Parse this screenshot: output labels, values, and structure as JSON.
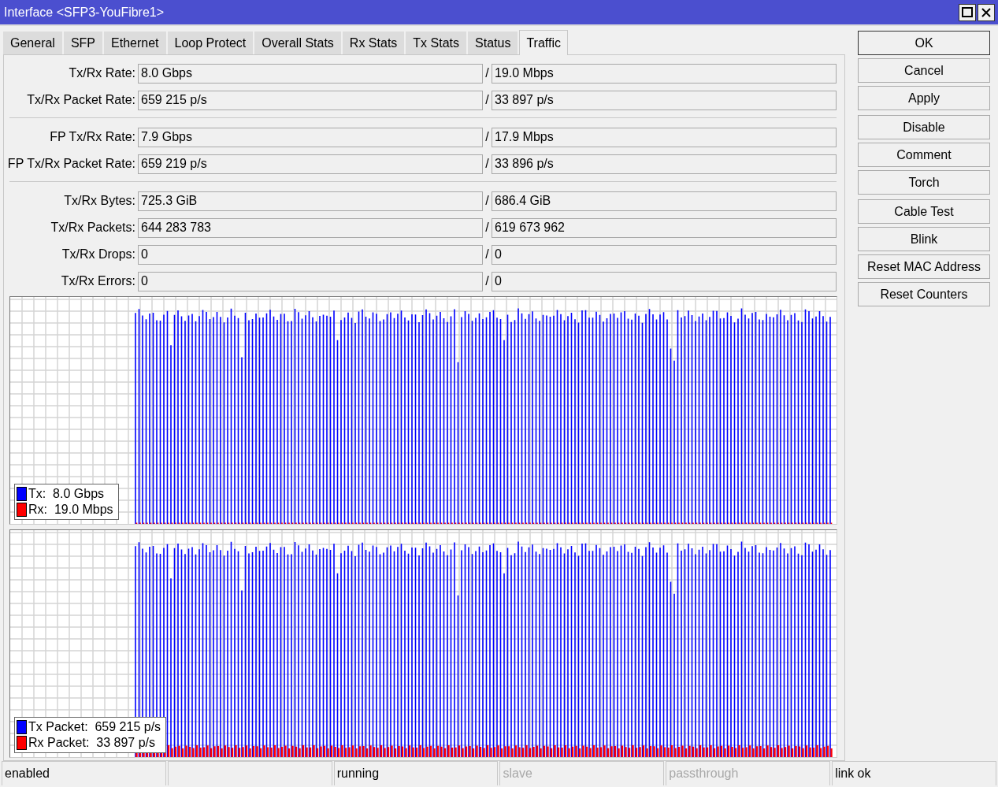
{
  "window": {
    "title": "Interface <SFP3-YouFibre1>"
  },
  "tabs": [
    {
      "label": "General",
      "selected": false
    },
    {
      "label": "SFP",
      "selected": false
    },
    {
      "label": "Ethernet",
      "selected": false
    },
    {
      "label": "Loop Protect",
      "selected": false
    },
    {
      "label": "Overall Stats",
      "selected": false
    },
    {
      "label": "Rx Stats",
      "selected": false
    },
    {
      "label": "Tx Stats",
      "selected": false
    },
    {
      "label": "Status",
      "selected": false
    },
    {
      "label": "Traffic",
      "selected": true
    }
  ],
  "groups": [
    {
      "rows": [
        {
          "label": "Tx/Rx Rate:",
          "tx": "8.0 Gbps",
          "sep": "/",
          "rx": "19.0 Mbps"
        },
        {
          "label": "Tx/Rx Packet Rate:",
          "tx": "659 215 p/s",
          "sep": "/",
          "rx": "33 897 p/s"
        }
      ]
    },
    {
      "rows": [
        {
          "label": "FP Tx/Rx Rate:",
          "tx": "7.9 Gbps",
          "sep": "/",
          "rx": "17.9 Mbps"
        },
        {
          "label": "FP Tx/Rx Packet Rate:",
          "tx": "659 219 p/s",
          "sep": "/",
          "rx": "33 896 p/s"
        }
      ]
    },
    {
      "rows": [
        {
          "label": "Tx/Rx Bytes:",
          "tx": "725.3 GiB",
          "sep": "/",
          "rx": "686.4 GiB"
        },
        {
          "label": "Tx/Rx Packets:",
          "tx": "644 283 783",
          "sep": "/",
          "rx": "619 673 962"
        },
        {
          "label": "Tx/Rx Drops:",
          "tx": "0",
          "sep": "/",
          "rx": "0"
        },
        {
          "label": "Tx/Rx Errors:",
          "tx": "0",
          "sep": "/",
          "rx": "0"
        }
      ]
    }
  ],
  "graphs": [
    {
      "kind": "rate",
      "legend": [
        {
          "label": "Tx:",
          "value": "8.0 Gbps",
          "color": "#0000ff"
        },
        {
          "label": "Rx:",
          "value": "19.0 Mbps",
          "color": "#ff0000"
        }
      ]
    },
    {
      "kind": "packets",
      "legend": [
        {
          "label": "Tx Packet:",
          "value": "659 215 p/s",
          "color": "#0000ff"
        },
        {
          "label": "Rx Packet:",
          "value": "33 897 p/s",
          "color": "#ff0000"
        }
      ]
    }
  ],
  "button_groups": [
    [
      "OK",
      "Cancel",
      "Apply"
    ],
    [
      "Disable",
      "Comment",
      "Torch"
    ],
    [
      "Cable Test",
      "Blink",
      "Reset MAC Address",
      "Reset Counters"
    ]
  ],
  "status_bar": [
    {
      "kind": "text",
      "text": "enabled",
      "disabled": false
    },
    {
      "kind": "blank"
    },
    {
      "kind": "text",
      "text": "running",
      "disabled": false
    },
    {
      "kind": "text",
      "text": "slave",
      "disabled": true
    },
    {
      "kind": "text",
      "text": "passthrough",
      "disabled": true
    },
    {
      "kind": "text",
      "text": "link ok",
      "disabled": false
    }
  ]
}
